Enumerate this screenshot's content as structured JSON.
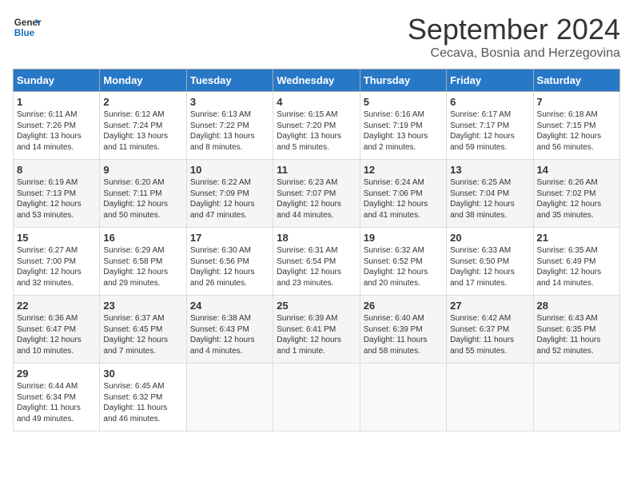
{
  "header": {
    "logo_line1": "General",
    "logo_line2": "Blue",
    "month": "September 2024",
    "location": "Cecava, Bosnia and Herzegovina"
  },
  "days_of_week": [
    "Sunday",
    "Monday",
    "Tuesday",
    "Wednesday",
    "Thursday",
    "Friday",
    "Saturday"
  ],
  "weeks": [
    [
      {
        "day": "1",
        "sunrise": "6:11 AM",
        "sunset": "7:26 PM",
        "daylight": "13 hours and 14 minutes."
      },
      {
        "day": "2",
        "sunrise": "6:12 AM",
        "sunset": "7:24 PM",
        "daylight": "13 hours and 11 minutes."
      },
      {
        "day": "3",
        "sunrise": "6:13 AM",
        "sunset": "7:22 PM",
        "daylight": "13 hours and 8 minutes."
      },
      {
        "day": "4",
        "sunrise": "6:15 AM",
        "sunset": "7:20 PM",
        "daylight": "13 hours and 5 minutes."
      },
      {
        "day": "5",
        "sunrise": "6:16 AM",
        "sunset": "7:19 PM",
        "daylight": "13 hours and 2 minutes."
      },
      {
        "day": "6",
        "sunrise": "6:17 AM",
        "sunset": "7:17 PM",
        "daylight": "12 hours and 59 minutes."
      },
      {
        "day": "7",
        "sunrise": "6:18 AM",
        "sunset": "7:15 PM",
        "daylight": "12 hours and 56 minutes."
      }
    ],
    [
      {
        "day": "8",
        "sunrise": "6:19 AM",
        "sunset": "7:13 PM",
        "daylight": "12 hours and 53 minutes."
      },
      {
        "day": "9",
        "sunrise": "6:20 AM",
        "sunset": "7:11 PM",
        "daylight": "12 hours and 50 minutes."
      },
      {
        "day": "10",
        "sunrise": "6:22 AM",
        "sunset": "7:09 PM",
        "daylight": "12 hours and 47 minutes."
      },
      {
        "day": "11",
        "sunrise": "6:23 AM",
        "sunset": "7:07 PM",
        "daylight": "12 hours and 44 minutes."
      },
      {
        "day": "12",
        "sunrise": "6:24 AM",
        "sunset": "7:06 PM",
        "daylight": "12 hours and 41 minutes."
      },
      {
        "day": "13",
        "sunrise": "6:25 AM",
        "sunset": "7:04 PM",
        "daylight": "12 hours and 38 minutes."
      },
      {
        "day": "14",
        "sunrise": "6:26 AM",
        "sunset": "7:02 PM",
        "daylight": "12 hours and 35 minutes."
      }
    ],
    [
      {
        "day": "15",
        "sunrise": "6:27 AM",
        "sunset": "7:00 PM",
        "daylight": "12 hours and 32 minutes."
      },
      {
        "day": "16",
        "sunrise": "6:29 AM",
        "sunset": "6:58 PM",
        "daylight": "12 hours and 29 minutes."
      },
      {
        "day": "17",
        "sunrise": "6:30 AM",
        "sunset": "6:56 PM",
        "daylight": "12 hours and 26 minutes."
      },
      {
        "day": "18",
        "sunrise": "6:31 AM",
        "sunset": "6:54 PM",
        "daylight": "12 hours and 23 minutes."
      },
      {
        "day": "19",
        "sunrise": "6:32 AM",
        "sunset": "6:52 PM",
        "daylight": "12 hours and 20 minutes."
      },
      {
        "day": "20",
        "sunrise": "6:33 AM",
        "sunset": "6:50 PM",
        "daylight": "12 hours and 17 minutes."
      },
      {
        "day": "21",
        "sunrise": "6:35 AM",
        "sunset": "6:49 PM",
        "daylight": "12 hours and 14 minutes."
      }
    ],
    [
      {
        "day": "22",
        "sunrise": "6:36 AM",
        "sunset": "6:47 PM",
        "daylight": "12 hours and 10 minutes."
      },
      {
        "day": "23",
        "sunrise": "6:37 AM",
        "sunset": "6:45 PM",
        "daylight": "12 hours and 7 minutes."
      },
      {
        "day": "24",
        "sunrise": "6:38 AM",
        "sunset": "6:43 PM",
        "daylight": "12 hours and 4 minutes."
      },
      {
        "day": "25",
        "sunrise": "6:39 AM",
        "sunset": "6:41 PM",
        "daylight": "12 hours and 1 minute."
      },
      {
        "day": "26",
        "sunrise": "6:40 AM",
        "sunset": "6:39 PM",
        "daylight": "11 hours and 58 minutes."
      },
      {
        "day": "27",
        "sunrise": "6:42 AM",
        "sunset": "6:37 PM",
        "daylight": "11 hours and 55 minutes."
      },
      {
        "day": "28",
        "sunrise": "6:43 AM",
        "sunset": "6:35 PM",
        "daylight": "11 hours and 52 minutes."
      }
    ],
    [
      {
        "day": "29",
        "sunrise": "6:44 AM",
        "sunset": "6:34 PM",
        "daylight": "11 hours and 49 minutes."
      },
      {
        "day": "30",
        "sunrise": "6:45 AM",
        "sunset": "6:32 PM",
        "daylight": "11 hours and 46 minutes."
      },
      null,
      null,
      null,
      null,
      null
    ]
  ]
}
